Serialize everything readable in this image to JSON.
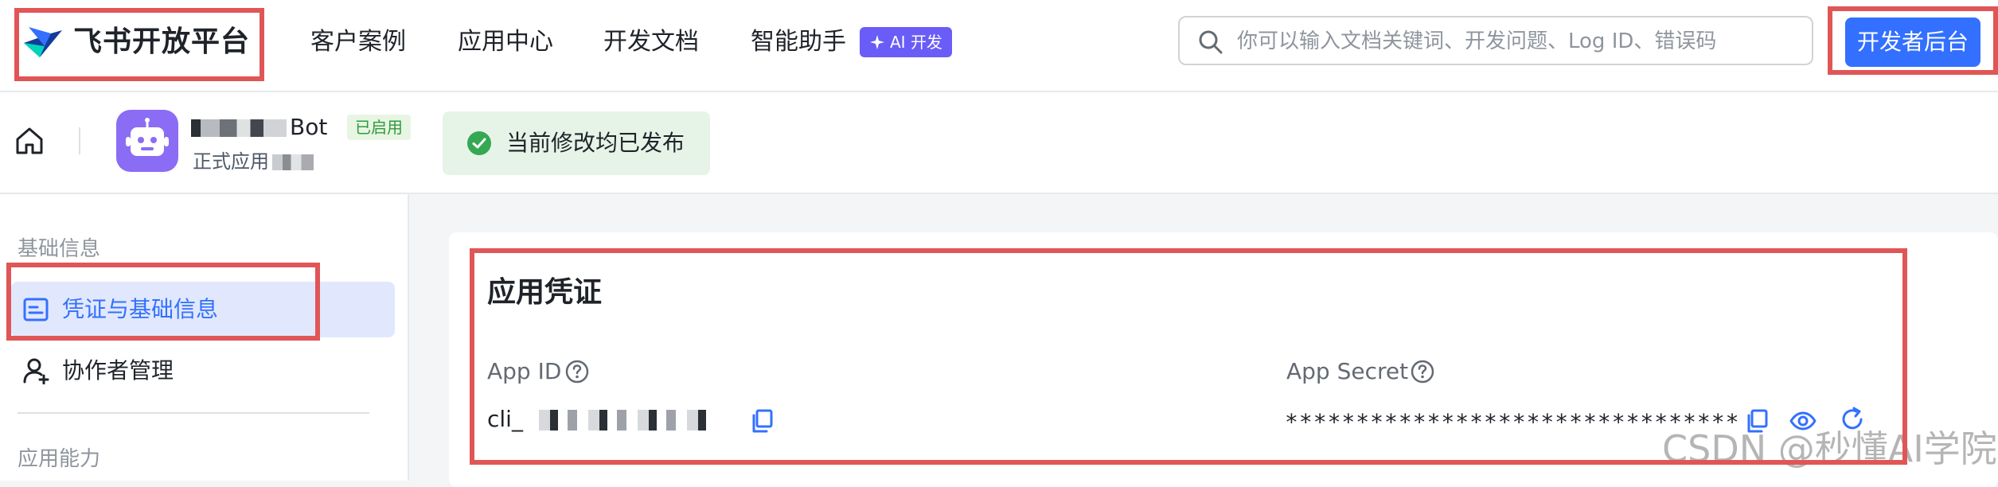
{
  "header": {
    "brand": "飞书开放平台",
    "nav": [
      {
        "label": "客户案例"
      },
      {
        "label": "应用中心"
      },
      {
        "label": "开发文档"
      },
      {
        "label": "智能助手"
      }
    ],
    "ai_badge": "AI 开发",
    "search_placeholder": "你可以输入文档关键词、开发问题、Log ID、错误码",
    "dev_console_button": "开发者后台"
  },
  "app": {
    "name_visible": "Bot",
    "status": "已启用",
    "type_label": "正式应用",
    "publish_status": "当前修改均已发布"
  },
  "sidebar": {
    "section_basic": "基础信息",
    "items": [
      {
        "label": "凭证与基础信息",
        "icon": "credential-icon",
        "active": true
      },
      {
        "label": "协作者管理",
        "icon": "add-user-icon",
        "active": false
      }
    ],
    "section_capability": "应用能力"
  },
  "credentials": {
    "title": "应用凭证",
    "app_id_label": "App ID",
    "app_id_prefix": "cli_",
    "app_secret_label": "App Secret",
    "app_secret_masked": "********************************"
  },
  "watermark": "CSDN @秒懂AI学院",
  "colors": {
    "primary": "#3370ff",
    "annotation_red": "#e05656",
    "ai_badge": "#6a5cf7",
    "success": "#2e9b3e",
    "app_avatar": "#8b6cf5"
  }
}
